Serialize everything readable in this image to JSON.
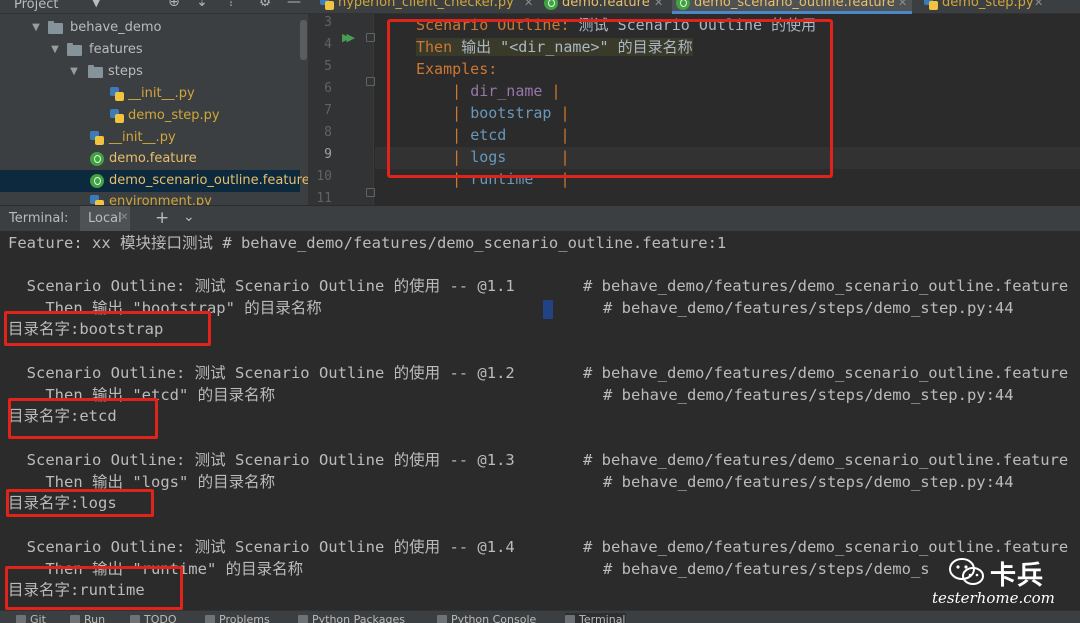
{
  "project": {
    "title": "Project",
    "tree": [
      {
        "label": "behave_demo",
        "type": "folder",
        "expanded": true
      },
      {
        "label": "features",
        "type": "folder",
        "expanded": true
      },
      {
        "label": "steps",
        "type": "folder",
        "expanded": true
      },
      {
        "label": "__init__.py",
        "type": "python"
      },
      {
        "label": "demo_step.py",
        "type": "python"
      },
      {
        "label": "__init__.py",
        "type": "python"
      },
      {
        "label": "demo.feature",
        "type": "feature"
      },
      {
        "label": "demo_scenario_outline.feature",
        "type": "feature",
        "selected": true
      },
      {
        "label": "environment.py",
        "type": "python"
      }
    ]
  },
  "editor": {
    "tabs": [
      {
        "label": "hyperion_client_checker.py"
      },
      {
        "label": "demo.feature"
      },
      {
        "label": "demo_scenario_outline.feature",
        "active": true
      },
      {
        "label": "demo_step.py"
      }
    ],
    "line_numbers": [
      "3",
      "4",
      "5",
      "6",
      "7",
      "8",
      "9",
      "10",
      "11"
    ],
    "current_line": "9",
    "code": {
      "l3_kw": "Scenario Outline:",
      "l3_text": " 测试 Scenario Outline 的使用",
      "l4_kw": "Then",
      "l4_text": " 输出 \"<dir_name>\" 的目录名称",
      "l5_kw": "Examples:",
      "rows": [
        {
          "pre": "    | ",
          "cell": "dir_name",
          "post": " |"
        },
        {
          "pre": "    | ",
          "cell": "bootstrap",
          "post": " |"
        },
        {
          "pre": "    | ",
          "cell": "etcd",
          "post": "      |"
        },
        {
          "pre": "    | ",
          "cell": "logs",
          "post": "      |"
        },
        {
          "pre": "    | ",
          "cell": "runtime",
          "post": "   |"
        }
      ]
    }
  },
  "terminal": {
    "label": "Terminal:",
    "tab": "Local",
    "lines": [
      "Feature: xx 模块接口测试 # behave_demo/features/demo_scenario_outline.feature:1",
      "",
      "  Scenario Outline: 测试 Scenario Outline 的使用 -- @1.1",
      "    Then 输出 \"bootstrap\" 的目录名称",
      "目录名字:bootstrap",
      "",
      "  Scenario Outline: 测试 Scenario Outline 的使用 -- @1.2",
      "    Then 输出 \"etcd\" 的目录名称",
      "目录名字:etcd",
      "",
      "  Scenario Outline: 测试 Scenario Outline 的使用 -- @1.3",
      "    Then 输出 \"logs\" 的目录名称",
      "目录名字:logs",
      "",
      "  Scenario Outline: 测试 Scenario Outline 的使用 -- @1.4",
      "    Then 输出 \"runtime\" 的目录名称",
      "目录名字:runtime"
    ],
    "comments": {
      "outline": "# behave_demo/features/demo_scenario_outline.feature",
      "step": "# behave_demo/features/steps/demo_step.py:44",
      "step_partial": "# behave_demo/features/steps/demo_s"
    }
  },
  "bottom_bar": {
    "items": [
      "Git",
      "Run",
      "TODO",
      "Problems",
      "Python Packages",
      "Python Console",
      "Terminal"
    ],
    "active": "Terminal"
  },
  "watermark": {
    "brand": "卡兵",
    "site": "testerhome.com"
  },
  "colors": {
    "highlight_box": "#e0231b",
    "keyword": "#cc7832",
    "background": "#2b2b2b"
  }
}
